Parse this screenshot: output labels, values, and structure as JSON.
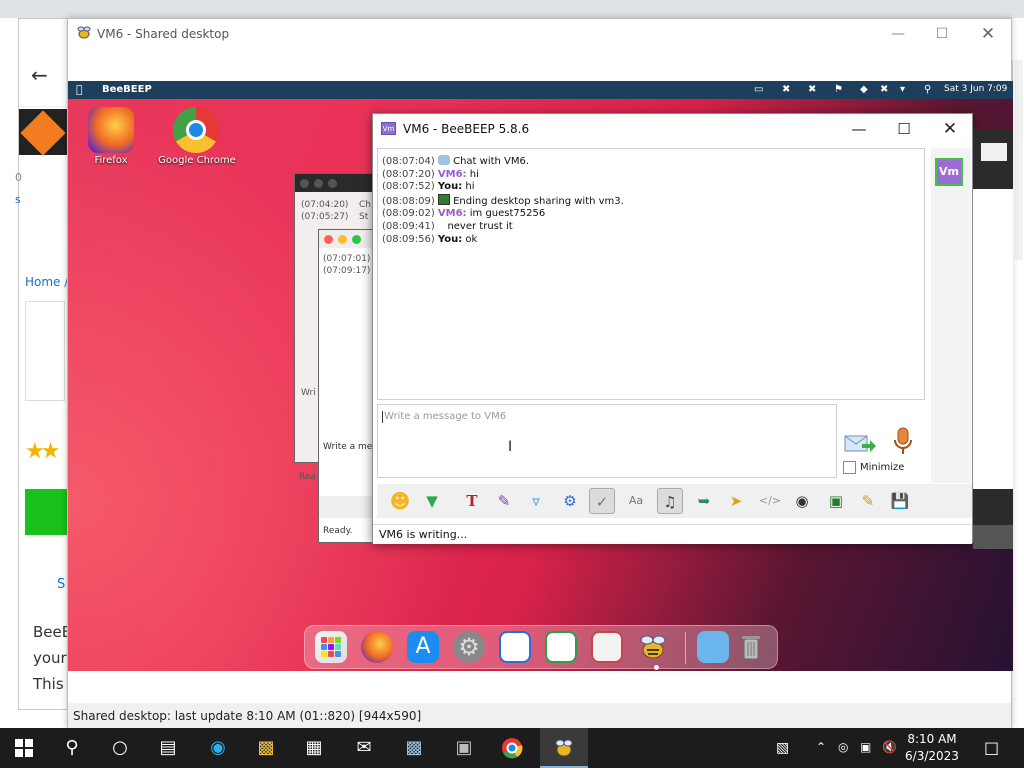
{
  "background_window": {
    "home_link": "Home /",
    "body_text": [
      "BeeB",
      "your",
      "This"
    ],
    "fragments": [
      "0",
      "s",
      "S"
    ]
  },
  "shared_window": {
    "title": "VM6 - Shared desktop",
    "status": "Shared desktop: last update 8:10 AM (01::820) [944x590]"
  },
  "remote": {
    "menubar_app": "BeeBEEP",
    "menubar_clock": "Sat 3 Jun 7:09",
    "desktop_icons": [
      {
        "label": "Firefox"
      },
      {
        "label": "Google Chrome"
      }
    ],
    "ghost_windows": {
      "back_lines": [
        "(07:04:20)",
        "(07:05:27)"
      ],
      "back_tail": [
        "Ch",
        "St"
      ],
      "front_lines": [
        "(07:07:01)",
        "(07:09:17)"
      ],
      "write_text": "Write a me",
      "write_short": "Wri",
      "ready": "Ready.",
      "rea": "Rea"
    }
  },
  "beebeep": {
    "title": "VM6 - BeeBEEP 5.8.6",
    "messages": [
      {
        "time": "(08:07:04)",
        "icon": "chat-bubble",
        "sender": "",
        "text": "Chat with VM6."
      },
      {
        "time": "(08:07:20)",
        "icon": "",
        "sender": "VM6:",
        "text": "hi"
      },
      {
        "time": "(08:07:52)",
        "icon": "",
        "sender": "You:",
        "text": "hi"
      },
      {
        "time": "(08:08:09)",
        "icon": "desktop-share",
        "sender": "",
        "text": "Ending desktop sharing with vm3."
      },
      {
        "time": "(08:09:02)",
        "icon": "",
        "sender": "VM6:",
        "text": "im guest75256"
      },
      {
        "time": "(08:09:41)",
        "icon": "",
        "sender": "",
        "text": "never trust it"
      },
      {
        "time": "(08:09:56)",
        "icon": "",
        "sender": "You:",
        "text": "ok"
      }
    ],
    "avatar": "Vm",
    "input_placeholder": "Write a message to VM6",
    "minimize_label": "Minimize",
    "status": "VM6 is writing..."
  },
  "taskbar": {
    "time": "8:10 AM",
    "date": "6/3/2023"
  },
  "colors": {
    "menubar": "#1e3f5c",
    "vm_name": "#9b59d0",
    "taskbar": "#1c1c1c"
  }
}
